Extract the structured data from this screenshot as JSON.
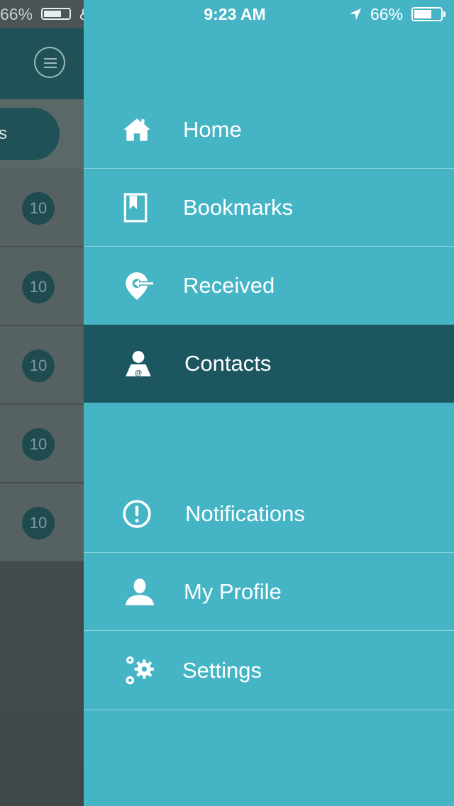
{
  "status_bar": {
    "time": "9:23 AM",
    "battery_percent": "66%",
    "battery_level": 0.66,
    "underlay_percent": "66%",
    "underlay_carrier": "&T"
  },
  "underlay": {
    "pill_text": "s",
    "badges": [
      "10",
      "10",
      "10",
      "10",
      "10"
    ]
  },
  "menu": {
    "items": [
      {
        "label": "Home",
        "icon": "home-icon"
      },
      {
        "label": "Bookmarks",
        "icon": "bookmark-icon"
      },
      {
        "label": "Received",
        "icon": "received-location-icon"
      },
      {
        "label": "Contacts",
        "icon": "contact-icon",
        "active": true
      },
      {
        "label": "Notifications",
        "icon": "exclamation-icon"
      },
      {
        "label": "My Profile",
        "icon": "person-icon"
      },
      {
        "label": "Settings",
        "icon": "gears-icon"
      }
    ]
  },
  "colors": {
    "menu_background": "#45b5c6",
    "active_item": "#1c5660",
    "divider": "#8fd3dc",
    "underlay": "#4a5454",
    "badge": "#1f4b50"
  }
}
